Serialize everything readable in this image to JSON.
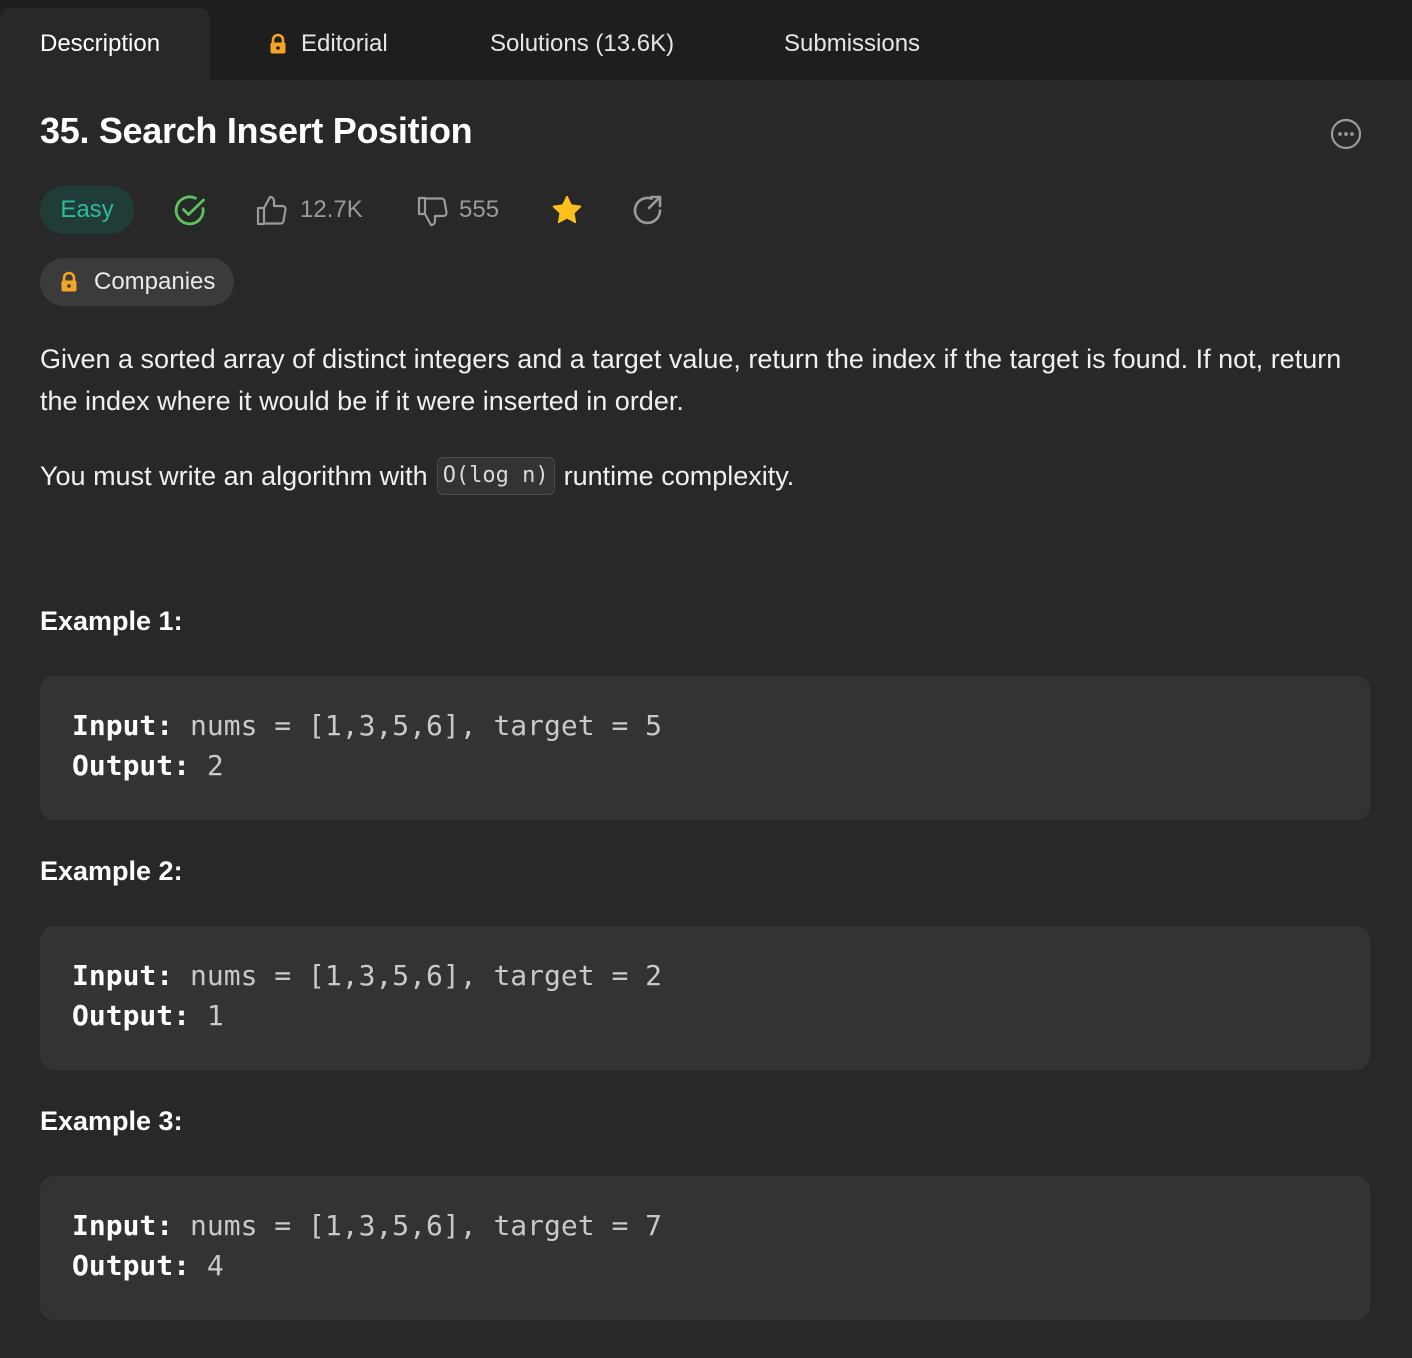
{
  "tabs": [
    {
      "label": "Description",
      "active": true,
      "locked": false
    },
    {
      "label": "Editorial",
      "active": false,
      "locked": true
    },
    {
      "label": "Solutions (13.6K)",
      "active": false,
      "locked": false
    },
    {
      "label": "Submissions",
      "active": false,
      "locked": false
    }
  ],
  "problem": {
    "title": "35. Search Insert Position",
    "difficulty": "Easy",
    "likes": "12.7K",
    "dislikes": "555",
    "companies_label": "Companies",
    "description_p1": "Given a sorted array of distinct integers and a target value, return the index if the target is found. If not, return the index where it would be if it were inserted in order.",
    "description_p2_before": "You must write an algorithm with",
    "description_p2_code": "O(log n)",
    "description_p2_after": "runtime complexity."
  },
  "examples": [
    {
      "title": "Example 1:",
      "input_label": "Input:",
      "input_value": " nums = [1,3,5,6], target = 5",
      "output_label": "Output:",
      "output_value": " 2"
    },
    {
      "title": "Example 2:",
      "input_label": "Input:",
      "input_value": " nums = [1,3,5,6], target = 2",
      "output_label": "Output:",
      "output_value": " 1"
    },
    {
      "title": "Example 3:",
      "input_label": "Input:",
      "input_value": " nums = [1,3,5,6], target = 7",
      "output_label": "Output:",
      "output_value": " 4"
    }
  ],
  "icons": {
    "lock": "lock-icon",
    "solved": "check-circle-icon",
    "like": "thumbs-up-icon",
    "dislike": "thumbs-down-icon",
    "favorite": "star-icon",
    "share": "share-icon",
    "more": "more-options-icon"
  },
  "colors": {
    "background": "#282828",
    "tabbar": "#1e1e1e",
    "easy_text": "#2cbb9b",
    "easy_bg": "#1f3c38",
    "solved_green": "#5cc45c",
    "lock_orange": "#f5a524",
    "star_yellow": "#ffc01e",
    "code_bg": "#333333"
  }
}
